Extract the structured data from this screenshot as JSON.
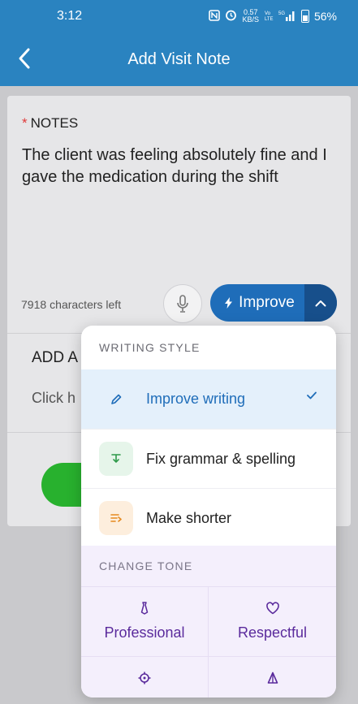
{
  "status_bar": {
    "time": "3:12",
    "net_speed": "0.57",
    "net_unit": "KB/S",
    "battery": "56%"
  },
  "app_bar": {
    "title": "Add Visit Note"
  },
  "notes": {
    "required_marker": "*",
    "label": "NOTES",
    "text": "The client was feeling absolutely fine and I gave the medication during the shift",
    "chars_left_count": "7918",
    "chars_left_label": "characters left"
  },
  "improve_button": {
    "label": "Improve"
  },
  "add_section": {
    "label_visible": "ADD A",
    "hint_visible": "Click h"
  },
  "dropdown": {
    "writing_style_header": "WRITING STYLE",
    "items": [
      {
        "label": "Improve writing",
        "selected": true,
        "icon": "pencil-icon"
      },
      {
        "label": "Fix grammar & spelling",
        "selected": false,
        "icon": "text-fix-icon"
      },
      {
        "label": "Make shorter",
        "selected": false,
        "icon": "shorten-icon"
      }
    ],
    "change_tone_header": "CHANGE TONE",
    "tones": [
      {
        "label": "Professional",
        "icon": "tie-icon"
      },
      {
        "label": "Respectful",
        "icon": "heart-icon"
      },
      {
        "label": "",
        "icon": "target-icon"
      },
      {
        "label": "",
        "icon": "triangle-icon"
      }
    ]
  },
  "colors": {
    "primary": "#2a83c0",
    "improve_button": "#1f6db9",
    "save_green": "#28b12e",
    "tone_purple": "#5a2a9c",
    "required_red": "#e03a3a"
  }
}
